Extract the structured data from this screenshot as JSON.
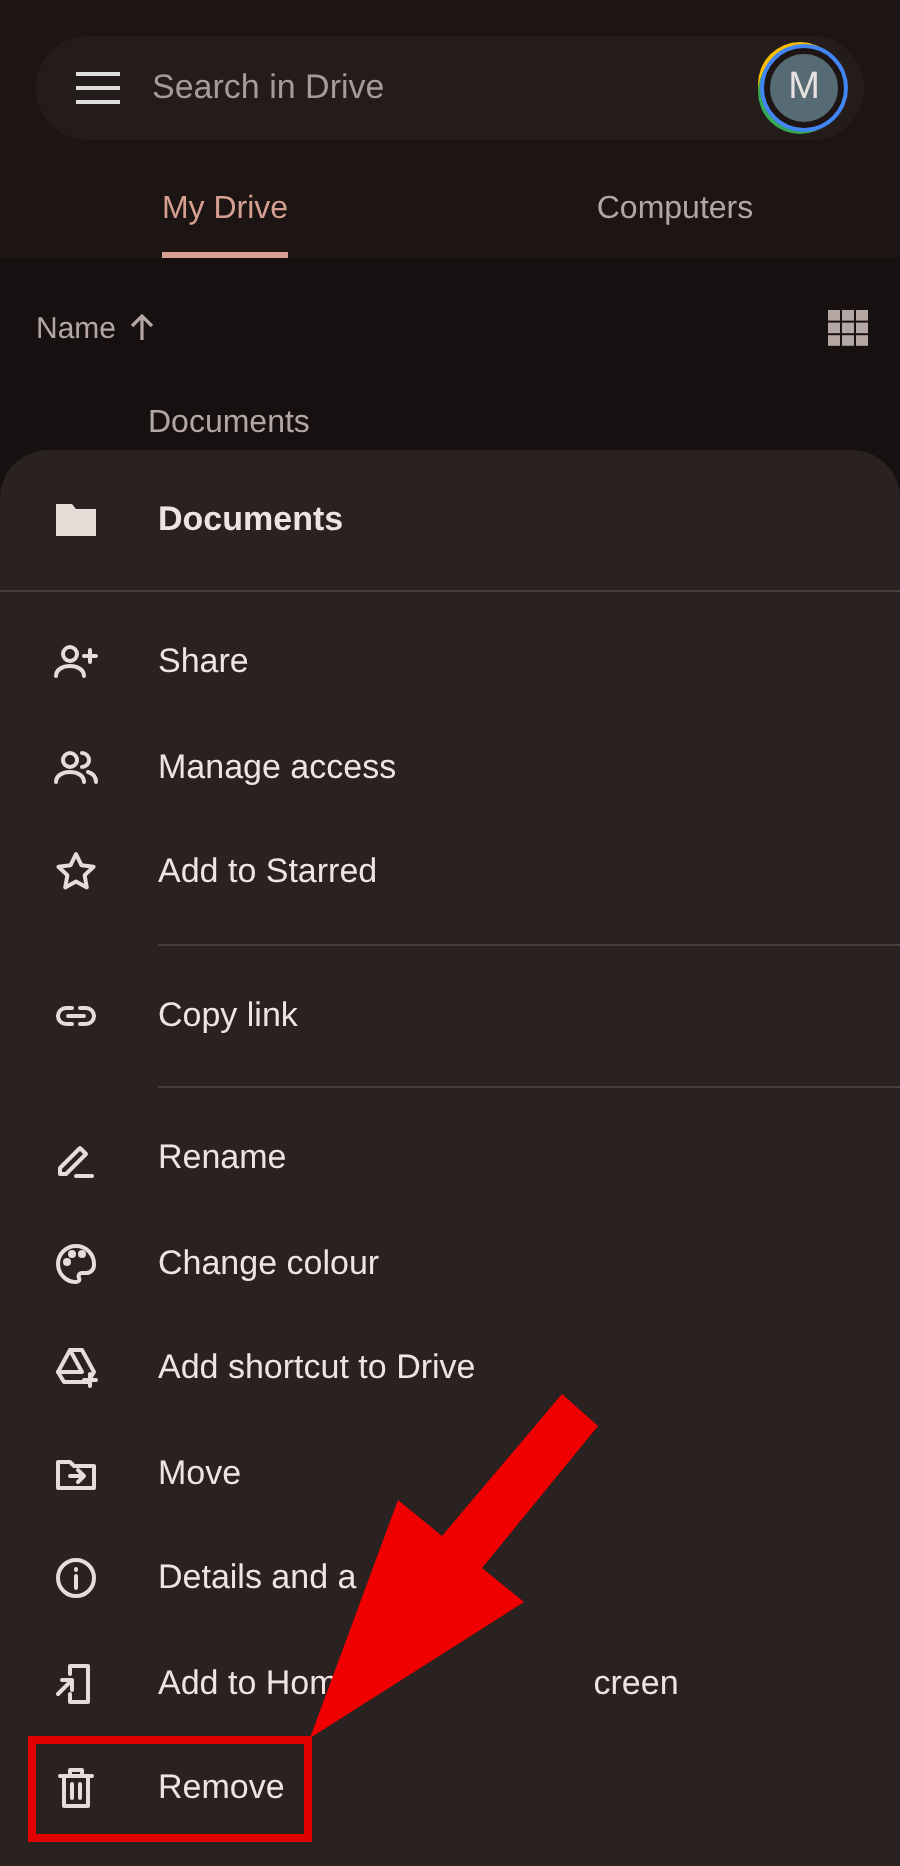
{
  "search": {
    "placeholder": "Search in Drive",
    "avatar": "M"
  },
  "tabs": [
    {
      "label": "My Drive",
      "selected": true
    },
    {
      "label": "Computers",
      "selected": false
    }
  ],
  "sort": {
    "label": "Name",
    "ascending": true
  },
  "background_file": "Documents",
  "sheet": {
    "title": "Documents",
    "groups": [
      [
        {
          "label": "Share",
          "highlighted": false
        },
        {
          "label": "Manage access",
          "highlighted": false
        },
        {
          "label": "Add to Starred",
          "highlighted": false
        }
      ],
      [
        {
          "label": "Copy link",
          "highlighted": false
        }
      ],
      [
        {
          "label": "Rename",
          "highlighted": false
        },
        {
          "label": "Change colour",
          "highlighted": false
        },
        {
          "label": "Add shortcut to Drive",
          "highlighted": false
        },
        {
          "label": "Move",
          "highlighted": false
        },
        {
          "label": "Details and a",
          "highlighted": false
        },
        {
          "label": "Add to Hom",
          "tail": "creen",
          "highlighted": false
        },
        {
          "label": "Remove",
          "highlighted": true
        }
      ]
    ]
  }
}
